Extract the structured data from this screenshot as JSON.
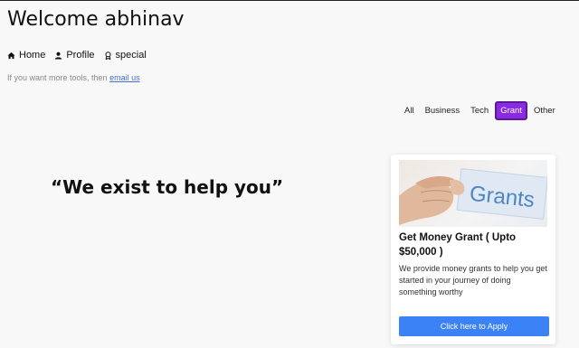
{
  "header": {
    "welcome": "Welcome abhinav"
  },
  "nav": {
    "items": [
      {
        "label": "Home",
        "icon": "home-icon"
      },
      {
        "label": "Profile",
        "icon": "user-icon"
      },
      {
        "label": "special",
        "icon": "badge-icon"
      }
    ]
  },
  "tools_line": {
    "prefix": "If you want more tools, then",
    "link": "email us"
  },
  "filters": {
    "items": [
      "All",
      "Business",
      "Tech",
      "Grant",
      "Other"
    ],
    "active": "Grant",
    "active_color": "#8a2be2"
  },
  "quote": "“We exist to help you”",
  "card": {
    "image_text": "Grants",
    "title": "Get Money Grant ( Upto $50,000 )",
    "description": "We provide money grants to help you get started in your journey of doing something worthy",
    "button_label": "Click here to Apply",
    "button_color": "#3b82f6"
  }
}
